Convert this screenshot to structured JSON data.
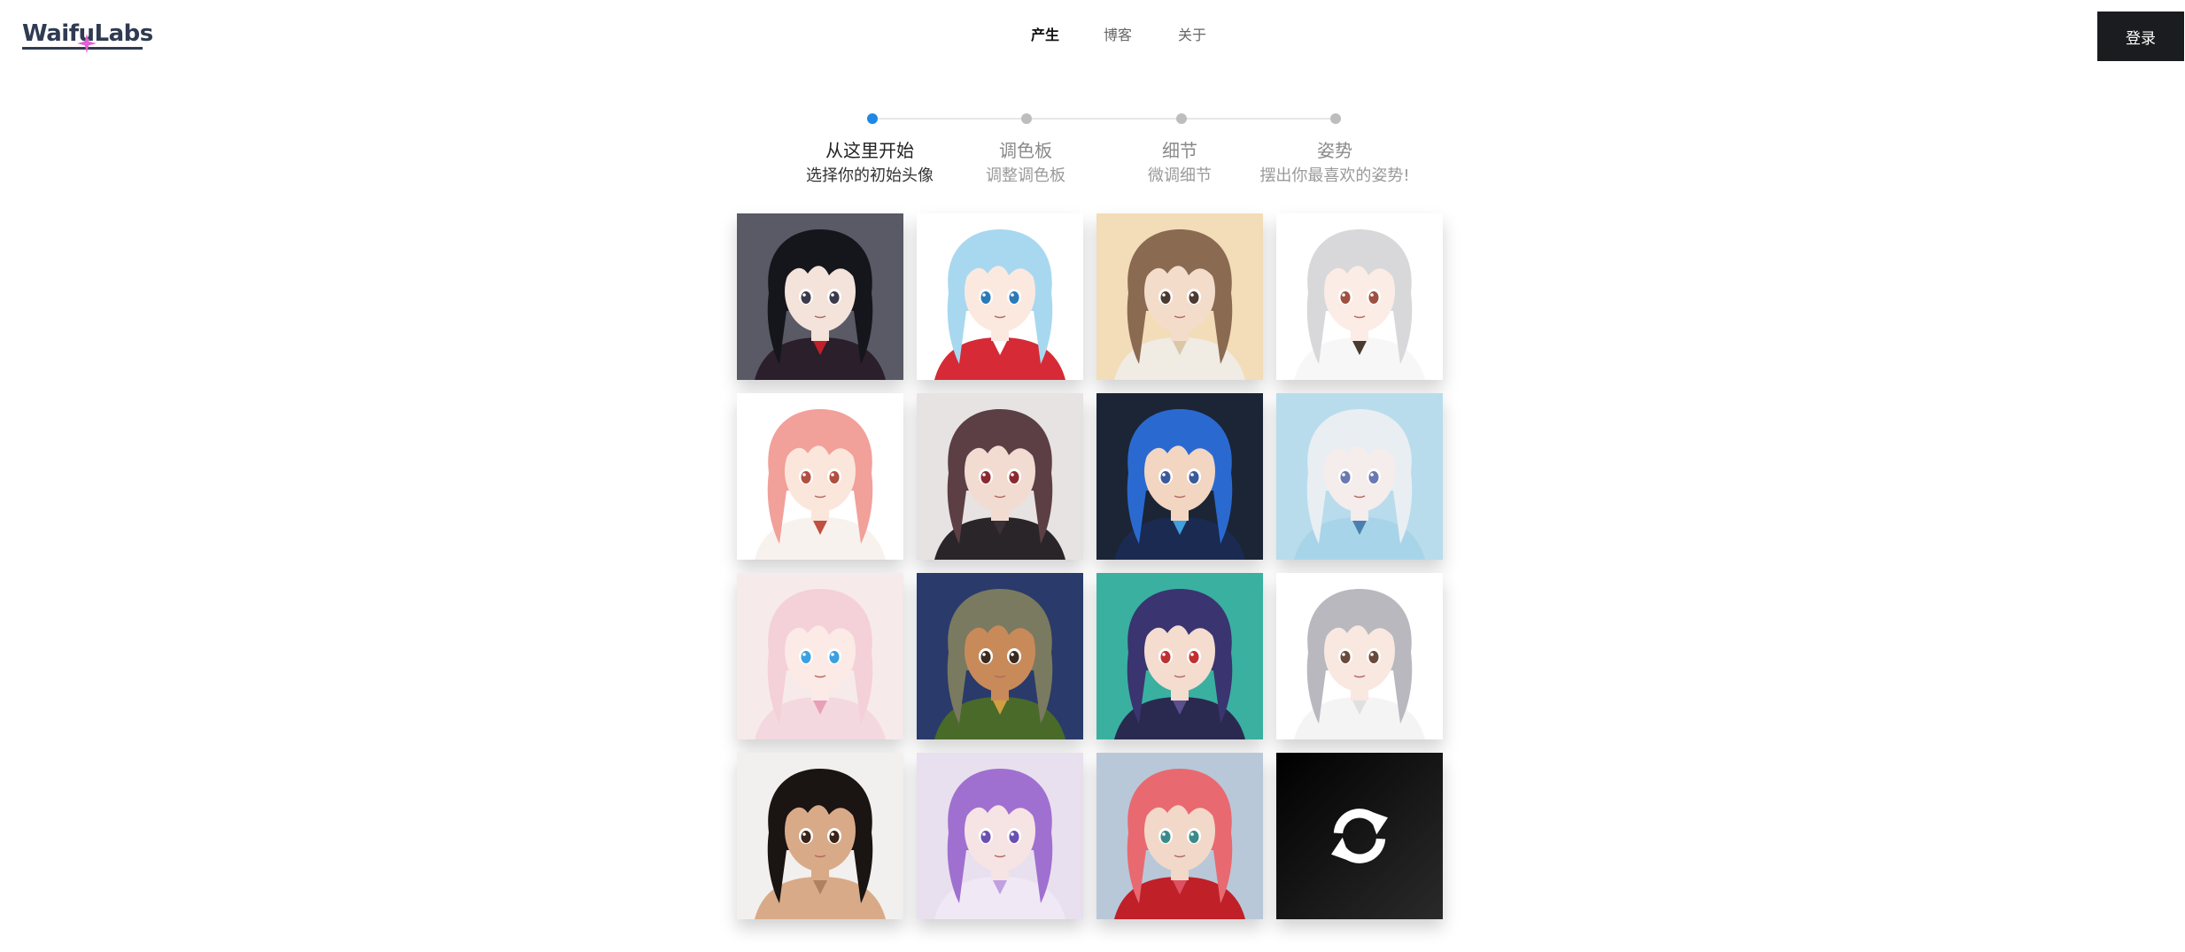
{
  "header": {
    "logo_text": "WaifuLabs",
    "nav": [
      {
        "label": "产生",
        "active": true
      },
      {
        "label": "博客",
        "active": false
      },
      {
        "label": "关于",
        "active": false
      }
    ],
    "login_label": "登录"
  },
  "stepper": {
    "steps": [
      {
        "title": "从这里开始",
        "subtitle": "选择你的初始头像",
        "active": true
      },
      {
        "title": "调色板",
        "subtitle": "调整调色板",
        "active": false
      },
      {
        "title": "细节",
        "subtitle": "微调细节",
        "active": false
      },
      {
        "title": "姿势",
        "subtitle": "摆出你最喜欢的姿势!",
        "active": false
      }
    ],
    "active_color": "#1e88e5",
    "inactive_color": "#bdbdbd"
  },
  "grid": {
    "portraits": [
      {
        "bg": "#5a5a66",
        "hair": "#15151c",
        "skin": "#f3e3da",
        "eyes": "#3a3a4a",
        "top": "#2a1f2a",
        "accent": "#c0202a"
      },
      {
        "bg": "#ffffff",
        "hair": "#a8d8f0",
        "skin": "#fbe9e0",
        "eyes": "#2a7ab8",
        "top": "#d62a36",
        "accent": "#ffffff"
      },
      {
        "bg": "#f3dcb8",
        "hair": "#8a6a50",
        "skin": "#f4dccb",
        "eyes": "#4a3a30",
        "top": "#f0ebe3",
        "accent": "#d9c8a8"
      },
      {
        "bg": "#ffffff",
        "hair": "#d8d8da",
        "skin": "#fbece6",
        "eyes": "#a05040",
        "top": "#f7f7f7",
        "accent": "#4a3a30"
      },
      {
        "bg": "#ffffff",
        "hair": "#f2a09a",
        "skin": "#fbe6dc",
        "eyes": "#b05040",
        "top": "#f8f2ee",
        "accent": "#c05040"
      },
      {
        "bg": "#e7e3e3",
        "hair": "#5b3f45",
        "skin": "#f2dcd2",
        "eyes": "#8a2a30",
        "top": "#2a2528",
        "accent": "#3a3035"
      },
      {
        "bg": "#1b2535",
        "hair": "#2a6ad0",
        "skin": "#f2d6c2",
        "eyes": "#3a5a9a",
        "top": "#1a2a50",
        "accent": "#40a0e0"
      },
      {
        "bg": "#b8dcec",
        "hair": "#e8eef2",
        "skin": "#f5ecec",
        "eyes": "#6a7ab0",
        "top": "#a8d4ea",
        "accent": "#4a80b0"
      },
      {
        "bg": "#f7eaea",
        "hair": "#f4d0d8",
        "skin": "#fbeae6",
        "eyes": "#3aa0e0",
        "top": "#f4d8e0",
        "accent": "#e8a0b8"
      },
      {
        "bg": "#2a3a6a",
        "hair": "#7a7a60",
        "skin": "#c98a5a",
        "eyes": "#3a2a20",
        "top": "#4a6a2a",
        "accent": "#d0a040"
      },
      {
        "bg": "#3ab0a0",
        "hair": "#3a3470",
        "skin": "#f4dccf",
        "eyes": "#c03030",
        "top": "#2a2a50",
        "accent": "#5a5090"
      },
      {
        "bg": "#ffffff",
        "hair": "#b8b8be",
        "skin": "#f8e8e0",
        "eyes": "#6a4a3a",
        "top": "#f4f4f4",
        "accent": "#e0e0e0"
      },
      {
        "bg": "#f2f0ee",
        "hair": "#1a1412",
        "skin": "#d9aa88",
        "eyes": "#3a2418",
        "top": "#d9aa88",
        "accent": "#b08060"
      },
      {
        "bg": "#e8e0ee",
        "hair": "#a070d0",
        "skin": "#f6e4e4",
        "eyes": "#6a50b0",
        "top": "#f0e8f4",
        "accent": "#c0a0e0"
      },
      {
        "bg": "#b8c8d8",
        "hair": "#e86a70",
        "skin": "#f2d8c8",
        "eyes": "#3a8a8a",
        "top": "#c02028",
        "accent": "#e05060"
      }
    ],
    "refresh_icon": "refresh-icon"
  }
}
